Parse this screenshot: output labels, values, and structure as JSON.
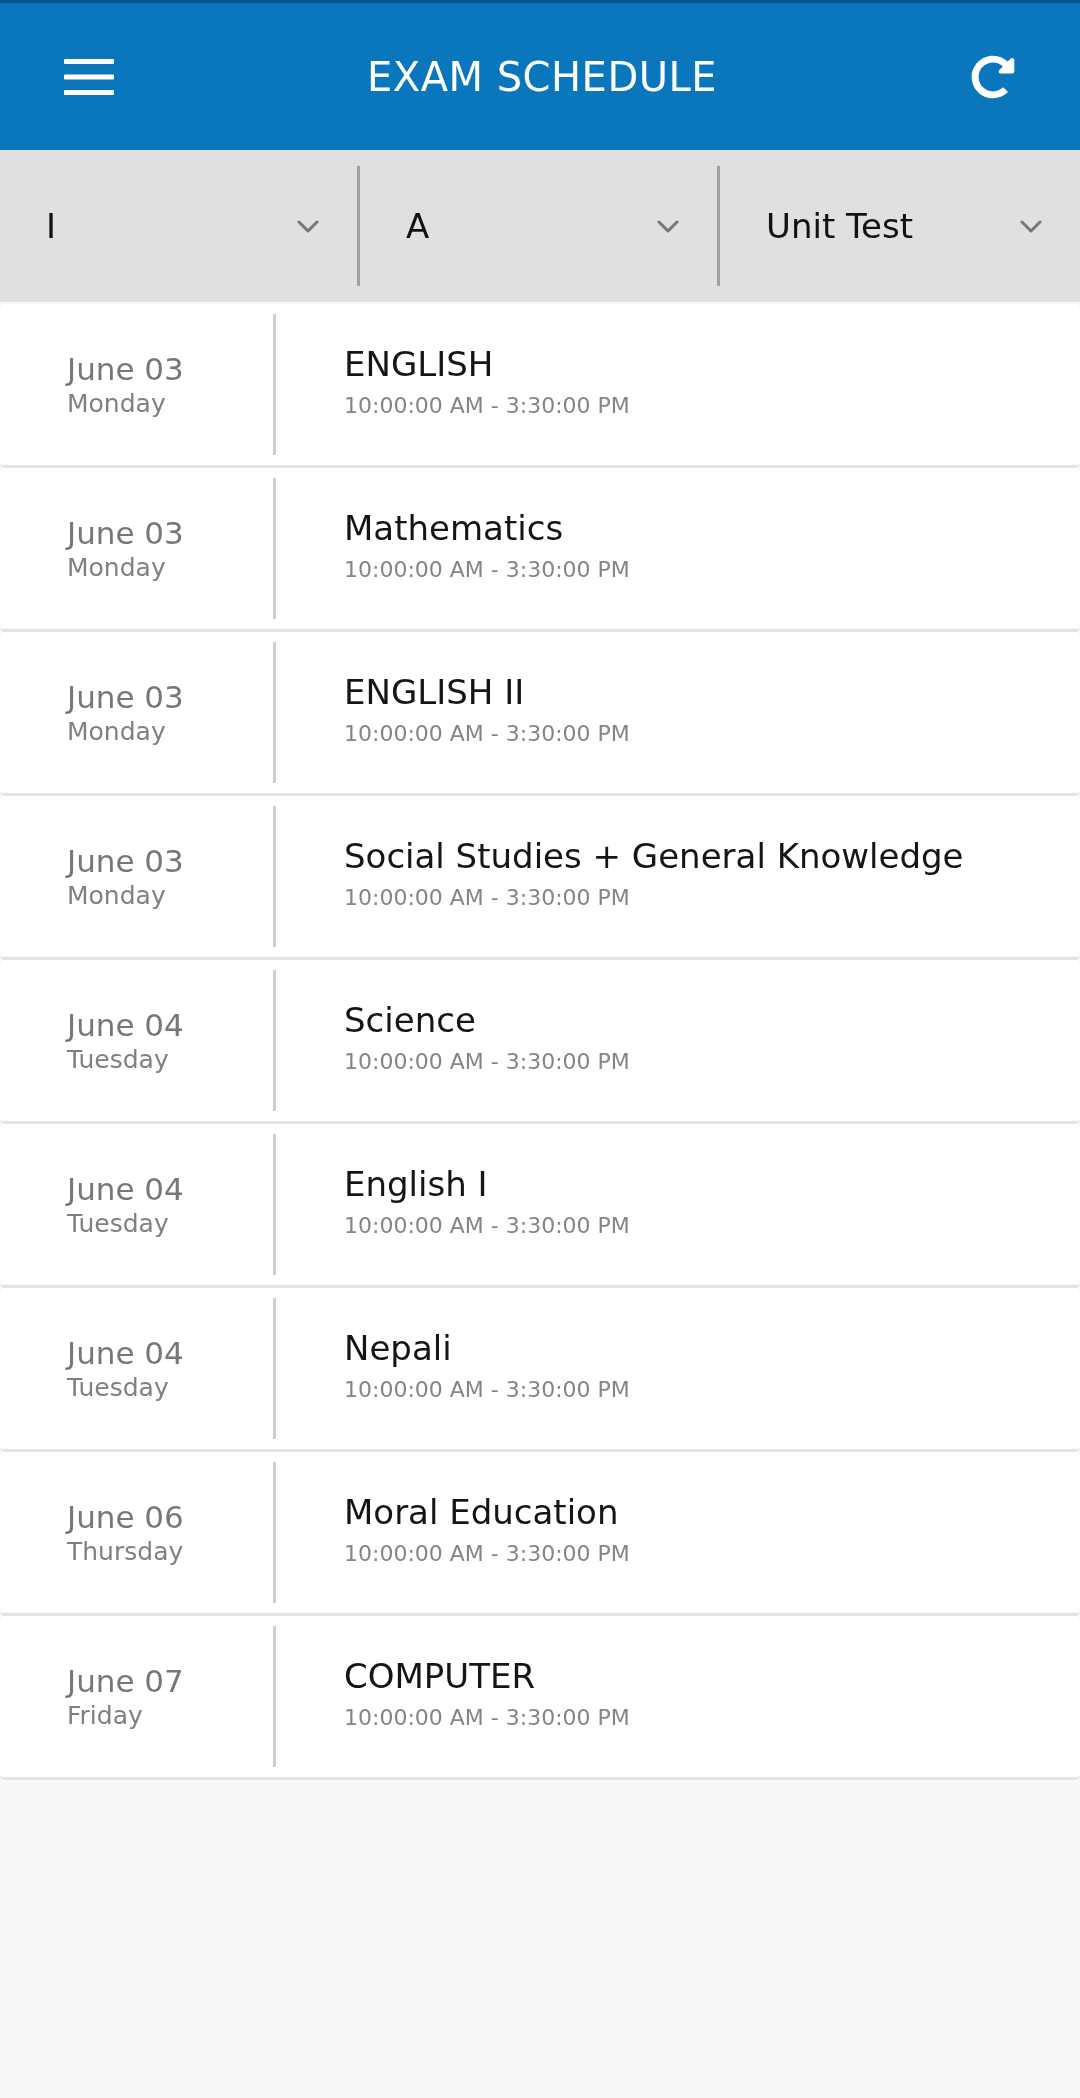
{
  "header": {
    "title": "EXAM SCHEDULE"
  },
  "filters": [
    {
      "value": "I"
    },
    {
      "value": "A"
    },
    {
      "value": "Unit Test"
    }
  ],
  "exams": [
    {
      "date": "June 03",
      "day": "Monday",
      "subject": "ENGLISH",
      "time": "10:00:00 AM - 3:30:00 PM"
    },
    {
      "date": "June 03",
      "day": "Monday",
      "subject": "Mathematics",
      "time": "10:00:00 AM - 3:30:00 PM"
    },
    {
      "date": "June 03",
      "day": "Monday",
      "subject": "ENGLISH II",
      "time": "10:00:00 AM - 3:30:00 PM"
    },
    {
      "date": "June 03",
      "day": "Monday",
      "subject": "Social Studies + General Knowledge",
      "time": "10:00:00 AM - 3:30:00 PM"
    },
    {
      "date": "June 04",
      "day": "Tuesday",
      "subject": "Science",
      "time": "10:00:00 AM - 3:30:00 PM"
    },
    {
      "date": "June 04",
      "day": "Tuesday",
      "subject": "English I",
      "time": "10:00:00 AM - 3:30:00 PM"
    },
    {
      "date": "June 04",
      "day": "Tuesday",
      "subject": "Nepali",
      "time": "10:00:00 AM - 3:30:00 PM"
    },
    {
      "date": "June 06",
      "day": "Thursday",
      "subject": "Moral Education",
      "time": "10:00:00 AM - 3:30:00 PM"
    },
    {
      "date": "June 07",
      "day": "Friday",
      "subject": "COMPUTER",
      "time": "10:00:00 AM - 3:30:00 PM"
    }
  ]
}
